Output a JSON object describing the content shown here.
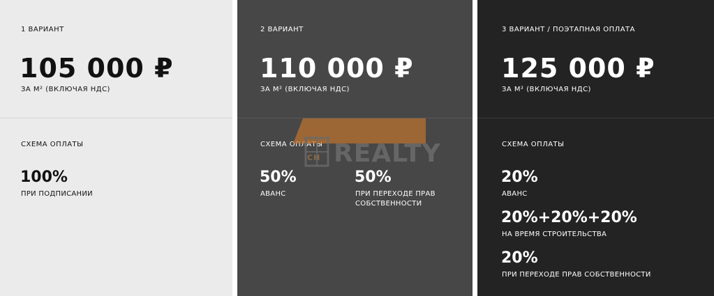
{
  "variants": [
    {
      "title": "1 ВАРИАНТ",
      "price": "105 000 ₽",
      "unit": "ЗА М² (ВКЛЮЧАЯ НДС)",
      "scheme_label": "СХЕМА ОПЛАТЫ",
      "payments": [
        {
          "percent": "100%",
          "caption": "ПРИ ПОДПИСАНИИ"
        }
      ]
    },
    {
      "title": "2 ВАРИАНТ",
      "price": "110 000 ₽",
      "unit": "ЗА М² (ВКЛЮЧАЯ НДС)",
      "scheme_label": "СХЕМА ОПЛАТЫ",
      "payments": [
        {
          "percent": "50%",
          "caption": "АВАНС"
        },
        {
          "percent": "50%",
          "caption": "ПРИ ПЕРЕХОДЕ ПРАВ СОБСТВЕННОСТИ"
        }
      ]
    },
    {
      "title": "3 ВАРИАНТ / ПОЭТАПНАЯ ОПЛАТА",
      "price": "125 000 ₽",
      "unit": "ЗА М² (ВКЛЮЧАЯ НДС)",
      "scheme_label": "СХЕМА ОПЛАТЫ",
      "payments": [
        {
          "percent": "20%",
          "caption": "АВАНС"
        },
        {
          "percent": "20%+20%+20%",
          "caption": "НА ВРЕМЯ СТРОИТЕЛЬСТВА"
        },
        {
          "percent": "20%",
          "caption": "ПРИ ПЕРЕХОДЕ ПРАВ СОБСТВЕННОСТИ"
        }
      ]
    }
  ],
  "watermark": {
    "text": "REALTY",
    "badge": "CH"
  },
  "colors": {
    "light": "#ebebeb",
    "mid": "#474747",
    "dark": "#232323",
    "roof": "#b8702f"
  }
}
